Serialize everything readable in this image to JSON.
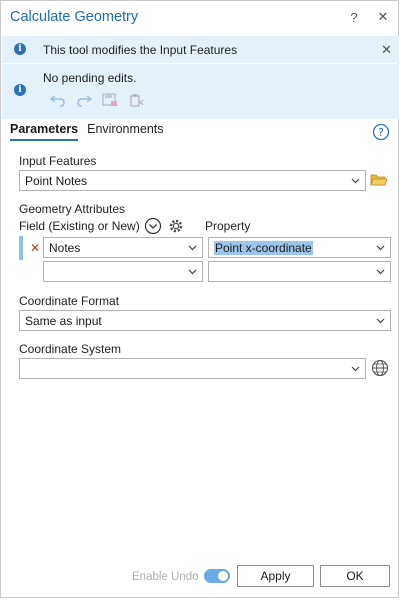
{
  "window": {
    "title": "Calculate Geometry",
    "help_label": "?",
    "close_label": "✕"
  },
  "banners": {
    "info_text": "This tool modifies the Input Features",
    "close_label": "✕",
    "edits_text": "No pending edits."
  },
  "tabs": [
    {
      "label": "Parameters",
      "active": true
    },
    {
      "label": "Environments",
      "active": false
    }
  ],
  "params": {
    "input_features_label": "Input Features",
    "input_features_value": "Point Notes",
    "geometry_attributes_label": "Geometry Attributes",
    "field_header": "Field (Existing or New)",
    "property_header": "Property",
    "rows": [
      {
        "field": "Notes",
        "property": "Point x-coordinate"
      },
      {
        "field": "",
        "property": ""
      }
    ],
    "coordinate_format_label": "Coordinate Format",
    "coordinate_format_value": "Same as input",
    "coordinate_system_label": "Coordinate System",
    "coordinate_system_value": ""
  },
  "footer": {
    "enable_undo_label": "Enable Undo",
    "enable_undo_on": true,
    "apply_label": "Apply",
    "ok_label": "OK"
  },
  "colors": {
    "accent": "#2c72b6",
    "title": "#1f6bb0",
    "banner_bg": "#e4f0fa",
    "selection": "#9cc6ee",
    "remove": "#c23434"
  }
}
